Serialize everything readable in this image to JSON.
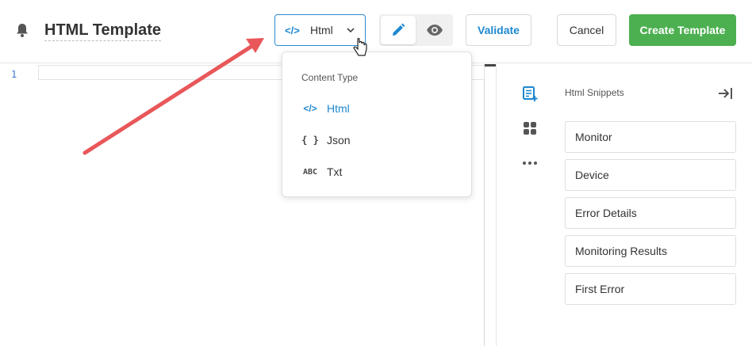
{
  "header": {
    "title": "HTML Template",
    "content_type_selected": "Html",
    "content_type_icon": "</>",
    "validate_label": "Validate",
    "cancel_label": "Cancel",
    "create_label": "Create Template"
  },
  "editor": {
    "line_numbers": [
      "1"
    ]
  },
  "dropdown": {
    "heading": "Content Type",
    "items": [
      {
        "icon": "</>",
        "label": "Html",
        "active": true
      },
      {
        "icon": "{ }",
        "label": "Json",
        "active": false
      },
      {
        "icon": "ABC",
        "label": "Txt",
        "active": false
      }
    ]
  },
  "snippets": {
    "title": "Html Snippets",
    "items": [
      "Monitor",
      "Device",
      "Error Details",
      "Monitoring Results",
      "First Error"
    ]
  },
  "colors": {
    "accent": "#1e88d0",
    "success": "#4caf50",
    "annotation_arrow": "#e8575a"
  },
  "icons": [
    "bell-icon",
    "code-icon",
    "chevron-down-icon",
    "pencil-icon",
    "eye-icon",
    "add-snippet-icon",
    "grid-icon",
    "more-icon",
    "collapse-right-icon",
    "hand-cursor-icon",
    "annotation-arrow"
  ]
}
